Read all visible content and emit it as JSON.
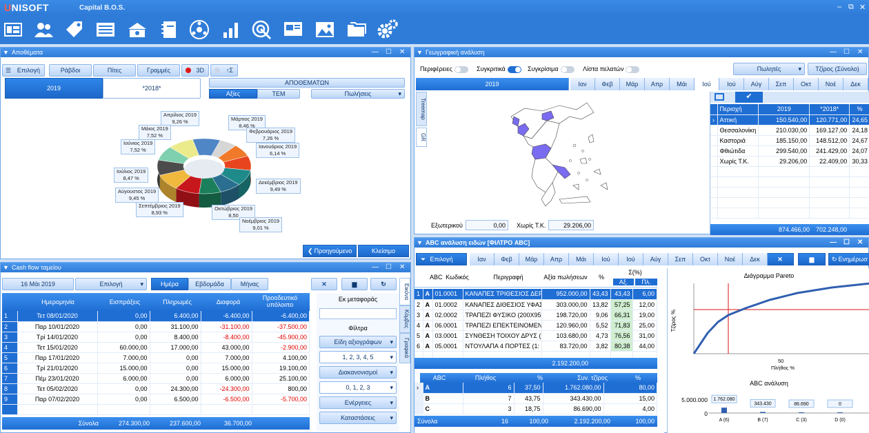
{
  "app": {
    "logo": "UNISOFT",
    "logo_prefix": "U",
    "name": "Capital B.O.S.",
    "controls": [
      "–",
      "⧉",
      "✕"
    ]
  },
  "toolbar": {
    "icons": [
      "dashboard-icon",
      "customers-icon",
      "tags-icon",
      "ledger-icon",
      "cash-icon",
      "notebook-icon",
      "network-icon",
      "team-icon",
      "bar-chart-icon",
      "target-icon",
      "presentation-icon",
      "image-icon",
      "folders-icon",
      "settings-icon"
    ]
  },
  "stock": {
    "title": "Αποθέματα",
    "buttons": {
      "select": "Επιλογή",
      "bars": "Ράβδοι",
      "pies": "Πίτες",
      "lines": "Γραμμές",
      "d3": "3D",
      "sum": "Σ"
    },
    "years": [
      "2019",
      "*2018*"
    ],
    "group_title": "ΑΠΟΘΕΜΑΤΩΝ",
    "modes": [
      "Αξίες",
      "ΤΕΜ"
    ],
    "dropdown": "Πωλήσεις",
    "prev": "Προηγούμενο",
    "close": "Κλείσιμο"
  },
  "chart_data": {
    "type": "pie",
    "categories": [
      "Ιανουάριος 2019",
      "Φεβρουάριος 2019",
      "Μάρτιος 2019",
      "Απρίλιος 2019",
      "Μάιος 2019",
      "Ιούνιος 2019",
      "Ιούλιος 2019",
      "Αύγουστος 2019",
      "Σεπτέμβριος 2019",
      "Οκτώβριος 2019",
      "Νοέμβριος 2019",
      "Δεκέμβριος 2019"
    ],
    "values": [
      6.14,
      7.26,
      8.46,
      9.26,
      7.52,
      7.52,
      8.47,
      9.45,
      8.93,
      8.5,
      9.01,
      9.49
    ],
    "labels": [
      "6,14 %",
      "7,26 %",
      "8,46 %",
      "9,26 %",
      "7,52 %",
      "7,52 %",
      "8,47 %",
      "9,45 %",
      "8,93 %",
      "8,50",
      "9,01 %",
      "9,49 %"
    ],
    "colors": [
      "#d6d6d6",
      "#f07a2a",
      "#e8451f",
      "#1e8b8a",
      "#2a6f8f",
      "#1a7f5a",
      "#c8161d",
      "#f0b83c",
      "#4c4c4c",
      "#7fd0ae",
      "#eceb8c",
      "#4f86c6"
    ]
  },
  "geo": {
    "title": "Γεωγραφική ανάλυση",
    "toggles": [
      {
        "label": "Περιφέρειες",
        "on": false
      },
      {
        "label": "Συγκριτικά",
        "on": true
      },
      {
        "label": "Συγκρίσιμα",
        "on": false
      },
      {
        "label": "Λίστα πελατών",
        "on": false
      }
    ],
    "sellers": "Πωλητές",
    "revenue": "Τζίρος (Σύνολο)",
    "year": "2019",
    "months": [
      "Ιαν",
      "Φεβ",
      "Μάρ",
      "Απρ",
      "Μάι",
      "Ιού",
      "Ιού",
      "Αύγ",
      "Σεπ",
      "Οκτ",
      "Νοέ",
      "Δεκ"
    ],
    "tabs": [
      "Treemap",
      "GR"
    ],
    "external_label": "Εξωτερικού",
    "external_value": "0,00",
    "notk_label": "Χωρίς Τ.Κ.",
    "notk_value": "29.206,00",
    "columns": [
      "Περιοχή",
      "2019",
      "*2018*",
      "%"
    ],
    "rows": [
      [
        "Αττική",
        "150.540,00",
        "120.771,00",
        "24,65"
      ],
      [
        "Θεσσαλονίκη",
        "210.030,00",
        "169.127,00",
        "24,18"
      ],
      [
        "Καστοριά",
        "185.150,00",
        "148.512,00",
        "24,67"
      ],
      [
        "Φθιώτιδα",
        "299.540,00",
        "241.429,00",
        "24,07"
      ],
      [
        "Χωρίς Τ.Κ.",
        "29.206,00",
        "22.409,00",
        "30,33"
      ]
    ],
    "totals": [
      "874.466,00",
      "702.248,00"
    ]
  },
  "cash": {
    "title": "Cash flow ταμείου",
    "date": "16 Μάι 2019",
    "select": "Επιλογή",
    "periods": [
      "Ημέρα",
      "Εβδομάδα",
      "Μήνας"
    ],
    "columns": [
      "Ημερομηνία",
      "Εισπράξεις",
      "Πληρωμές",
      "Διαφορά",
      "Προοδευτικό υπόλοιπο"
    ],
    "rows": [
      [
        "1",
        "Τετ 08/01/2020",
        "0,00",
        "6.400,00",
        "-6.400,00",
        "-6.400,00"
      ],
      [
        "2",
        "Παρ 10/01/2020",
        "0,00",
        "31.100,00",
        "-31.100,00",
        "-37.500,00"
      ],
      [
        "3",
        "Τρί 14/01/2020",
        "0,00",
        "8.400,00",
        "-8.400,00",
        "-45.900,00"
      ],
      [
        "4",
        "Τετ 15/01/2020",
        "60.000,00",
        "17.000,00",
        "43.000,00",
        "-2.900,00"
      ],
      [
        "5",
        "Παρ 17/01/2020",
        "7.000,00",
        "0,00",
        "7.000,00",
        "4.100,00"
      ],
      [
        "6",
        "Τρί 21/01/2020",
        "15.000,00",
        "0,00",
        "15.000,00",
        "19.100,00"
      ],
      [
        "7",
        "Πέμ 23/01/2020",
        "6.000,00",
        "0,00",
        "6.000,00",
        "25.100,00"
      ],
      [
        "8",
        "Τετ 05/02/2020",
        "0,00",
        "24.300,00",
        "-24.300,00",
        "800,00"
      ],
      [
        "9",
        "Παρ 07/02/2020",
        "0,00",
        "6.500,00",
        "-6.500,00",
        "-5.700,00"
      ]
    ],
    "totals_label": "Σύνολα",
    "totals": [
      "274.300,00",
      "237.600,00",
      "36.700,00"
    ],
    "side": {
      "transfer": "Εκ μεταφοράς",
      "filters": "Φίλτρα",
      "doc_types": "Είδη αξιογράφων",
      "doc_values": "1, 2, 3, 4, 5",
      "distributions": "Διακανονισμοί",
      "dist_values": "0, 1, 2, 3",
      "actions": "Ενέργειες",
      "states": "Καταστάσεις"
    },
    "vtabs": [
      "Εικόνα",
      "Κόμβος",
      "Γραφικά"
    ]
  },
  "abc": {
    "title": "ABC ανάλυση ειδών [ΦΙΛΤΡΟ ABC]",
    "select": "Επιλογή",
    "months": [
      "Ιαν",
      "Φεβ",
      "Μάρ",
      "Απρ",
      "Μάι",
      "Ιού",
      "Ιού",
      "Αύγ",
      "Σεπ",
      "Οκτ",
      "Νοέ",
      "Δεκ"
    ],
    "more": "Ενημέρωσ",
    "columns": [
      "ABC",
      "Κωδικός",
      "Περιγραφή",
      "Αξία πωλήσεων",
      "%",
      "Σ(%)",
      "Αξ.",
      "Πλ."
    ],
    "rows": [
      [
        "1",
        "A",
        "01.0001",
        "ΚΑΝΑΠΕΣ ΤΡΙΘΕΣΙΟΣ ΔΕΡ",
        "952.000,00",
        "43,43",
        "43,43",
        "6,00"
      ],
      [
        "2",
        "A",
        "01.0002",
        "ΚΑΝΑΠΕΣ ΔΙΘΕΣΙΟΣ ΥΦΑΣ",
        "303.000,00",
        "13,82",
        "57,25",
        "12,00"
      ],
      [
        "3",
        "A",
        "02.0002",
        "ΤΡΑΠΕΖΙ ΦΥΣΙΚΟ (200Χ95",
        "198.720,00",
        "9,06",
        "66,31",
        "19,00"
      ],
      [
        "4",
        "A",
        "06.0001",
        "ΤΡΑΠΕΖΙ ΕΠΕΚΤΕΙΝΟΜΕΝ",
        "120.960,00",
        "5,52",
        "71,83",
        "25,00"
      ],
      [
        "5",
        "A",
        "03.0001",
        "ΣΥΝΘΕΣΗ ΤΟΙΧΟΥ ΔΡΥΣ (",
        "103.680,00",
        "4,73",
        "76,56",
        "31,00"
      ],
      [
        "6",
        "A",
        "05.0001",
        "ΝΤΟΥΛΑΠΑ 4 ΠΟΡΤΕΣ (1:",
        "83.720,00",
        "3,82",
        "80,38",
        "44,00"
      ]
    ],
    "total": "2.192.200,00",
    "sum_columns": [
      "ABC",
      "Πλήθος",
      "%",
      "Συν. τζίρος",
      "%"
    ],
    "sum_rows": [
      [
        "A",
        "6",
        "37,50",
        "1.762.080,00",
        "80,00"
      ],
      [
        "B",
        "7",
        "43,75",
        "343.430,00",
        "15,00"
      ],
      [
        "C",
        "3",
        "18,75",
        "86.690,00",
        "4,00"
      ]
    ],
    "sum_total": [
      "Σύνολα",
      "16",
      "100,00",
      "2.192.200,00",
      "100,00"
    ],
    "pareto": {
      "title": "Διάγραμμα Pareto",
      "ylabel": "Τζίρος %",
      "xlabel": "Πλήθος %",
      "xtick": "50"
    },
    "abc_chart": {
      "title": "ABC ανάλυση",
      "ytick_top": "5.000.000",
      "ytick_zero": "0",
      "values": [
        "1.762.080",
        "343.430",
        "86.690",
        "0"
      ],
      "cats": [
        "A (6)",
        "B (7)",
        "C (3)",
        "D (0)"
      ]
    }
  }
}
